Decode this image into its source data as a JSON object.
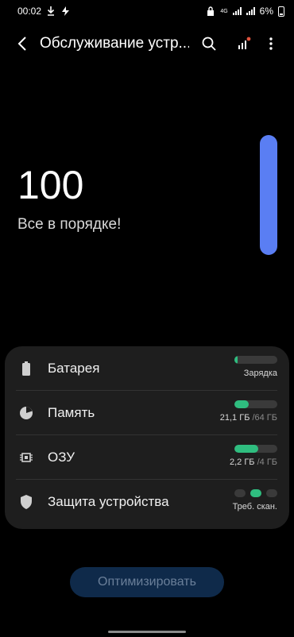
{
  "status_bar": {
    "time": "00:02",
    "network_label": "4G",
    "battery_percent": "6%"
  },
  "header": {
    "title": "Обслуживание устр..."
  },
  "score": {
    "value": "100",
    "status": "Все в порядке!",
    "gauge_color": "#5a7ef3"
  },
  "items": [
    {
      "label": "Батарея",
      "value": "Зарядка",
      "level": 0.02,
      "icon": "battery-icon"
    },
    {
      "label": "Память",
      "value_main": "21,1 ГБ",
      "value_dim": " /64 ГБ",
      "level": 0.33,
      "icon": "storage-icon"
    },
    {
      "label": "ОЗУ",
      "value_main": "2,2 ГБ",
      "value_dim": " /4 ГБ",
      "level": 0.55,
      "icon": "memory-chip-icon"
    },
    {
      "label": "Защита устройства",
      "value": "Треб. скан.",
      "icon": "shield-icon"
    }
  ],
  "optimize_button": {
    "label": "Оптимизировать"
  },
  "colors": {
    "accent_green": "#2fbd7f",
    "card_background": "#1e1e1e",
    "button_background": "#0f2a4a"
  }
}
